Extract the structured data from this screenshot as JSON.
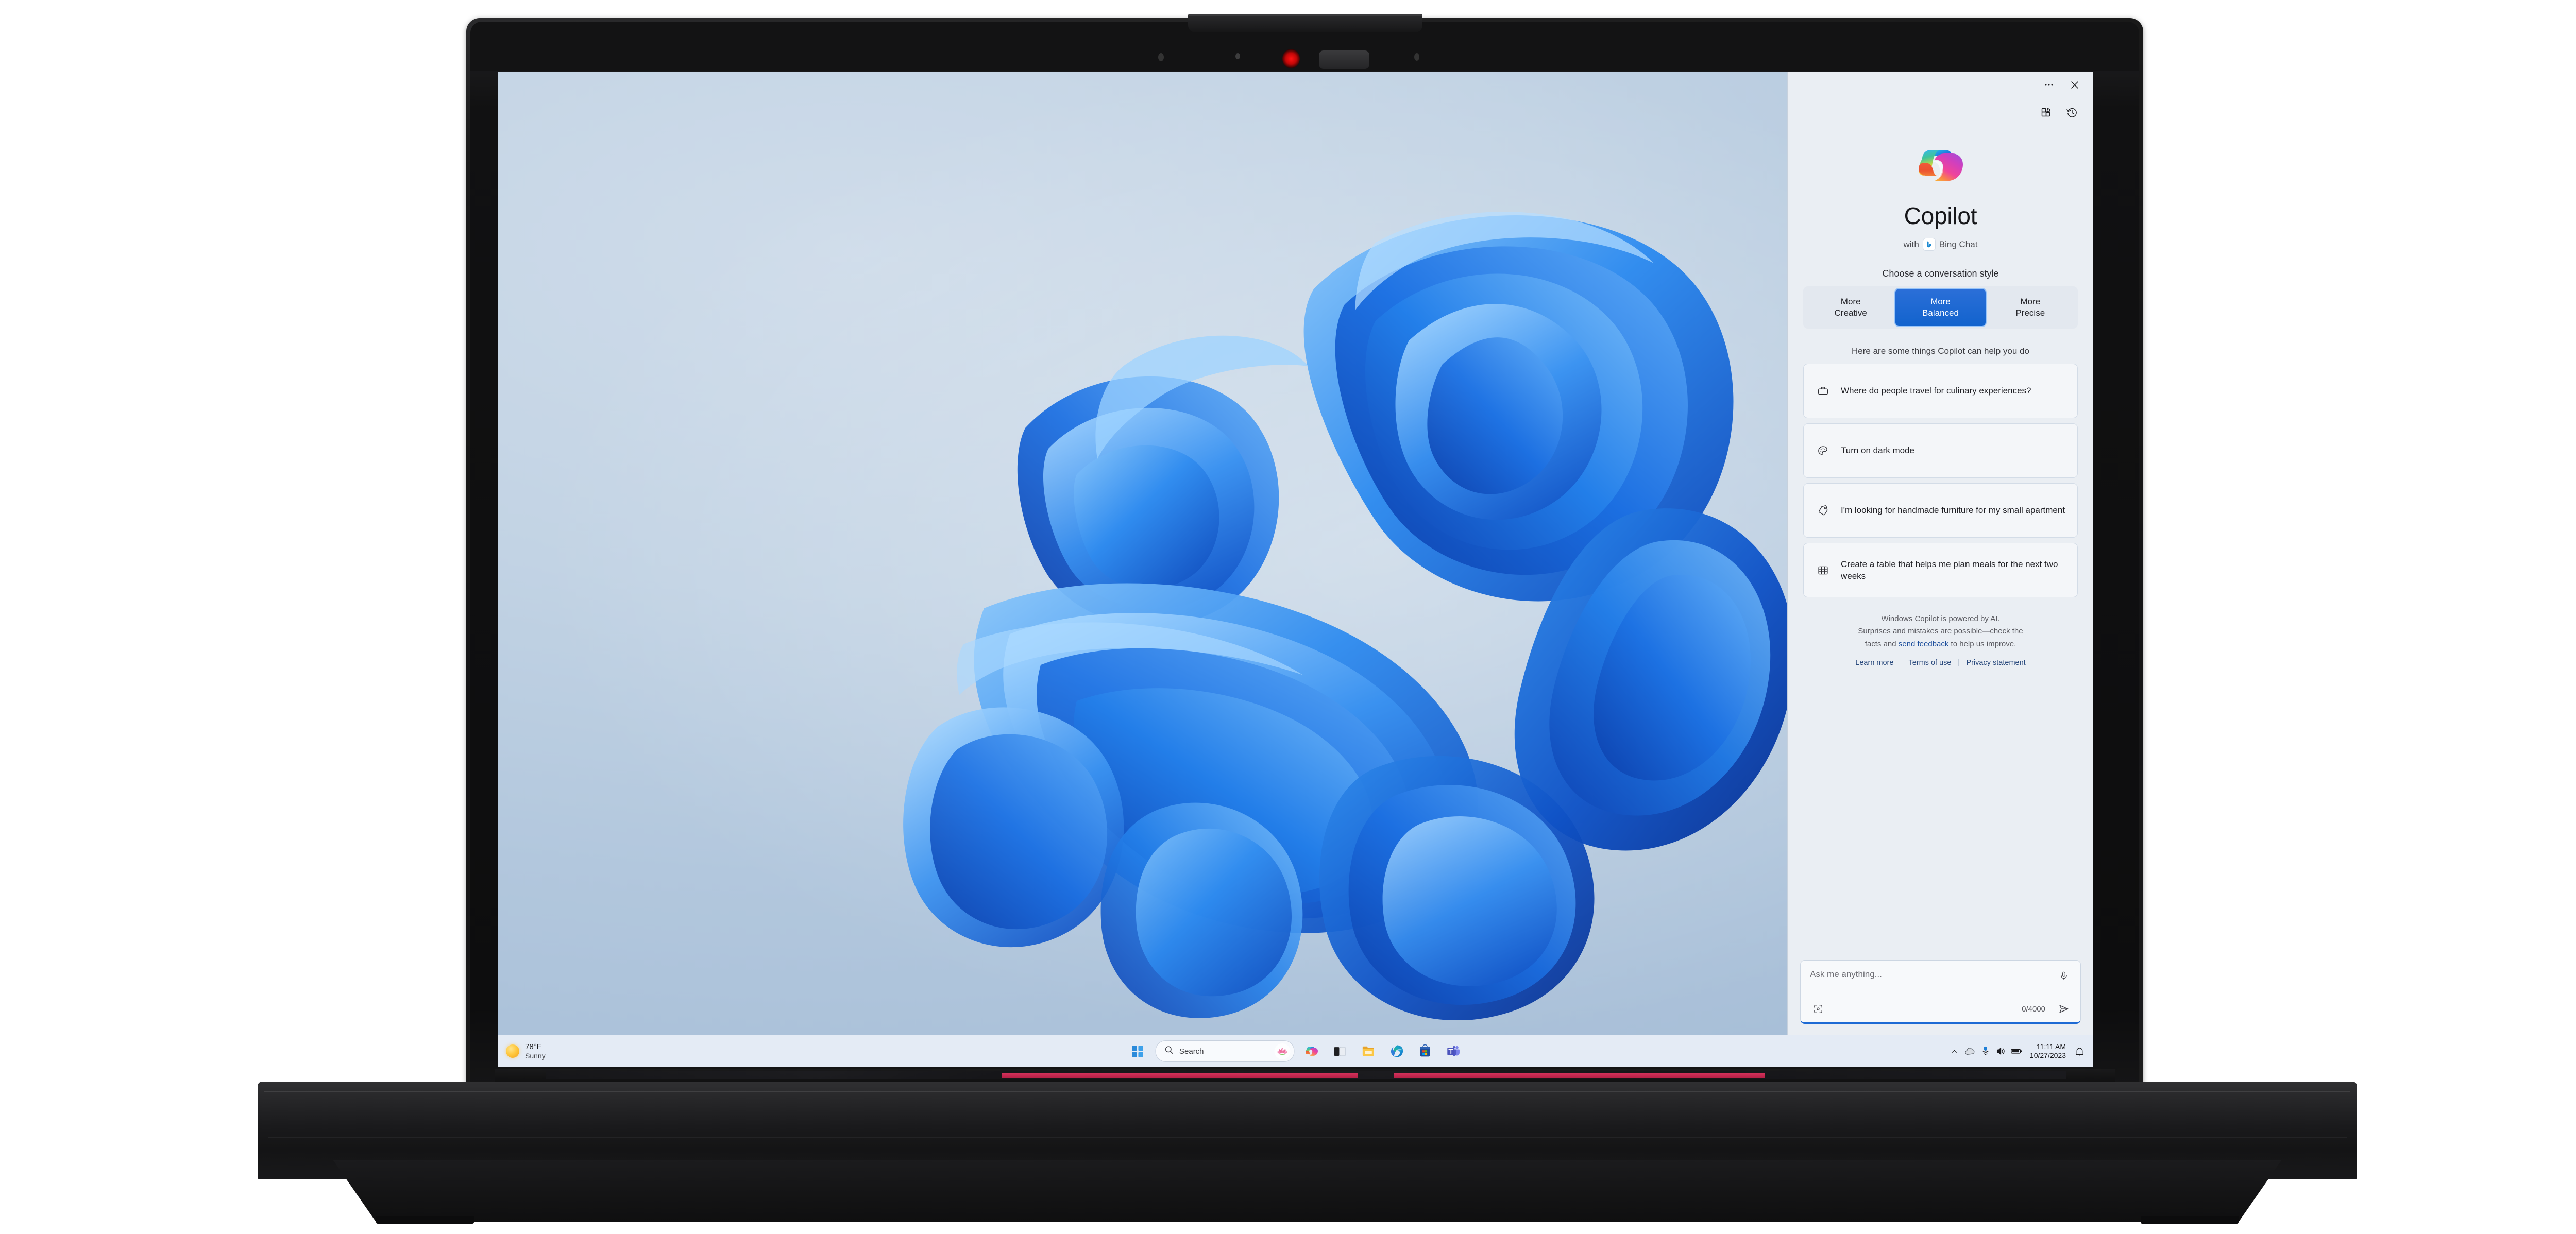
{
  "device": {
    "name": "thinkpad-laptop",
    "webcam": "privacy-shutter-webcam"
  },
  "desktop": {
    "wallpaper_name": "windows-11-bloom",
    "wallpaper_colors": {
      "bg_light": "#cfdcea",
      "bg_deep": "#a8bfd8",
      "petal_mid": "#1f7ae6",
      "petal_light": "#63b2f7",
      "petal_dark": "#0b3fae"
    }
  },
  "taskbar": {
    "weather": {
      "temperature": "78°F",
      "condition": "Sunny",
      "icon": "sun-icon"
    },
    "start_icon": "windows-start-icon",
    "search": {
      "placeholder": "Search",
      "icon": "search-icon",
      "badge_icon": "lotus-icon"
    },
    "apps": [
      {
        "name": "copilot",
        "label": "Copilot",
        "icon": "copilot-icon"
      },
      {
        "name": "task-view",
        "label": "Task View",
        "icon": "task-view-icon"
      },
      {
        "name": "file-explorer",
        "label": "File Explorer",
        "icon": "folder-icon"
      },
      {
        "name": "edge",
        "label": "Microsoft Edge",
        "icon": "edge-icon"
      },
      {
        "name": "store",
        "label": "Microsoft Store",
        "icon": "store-icon"
      },
      {
        "name": "teams",
        "label": "Microsoft Teams",
        "icon": "teams-icon"
      }
    ],
    "tray": {
      "chevron": "chevron-up-icon",
      "onedrive": "cloud-icon",
      "network": "wifi-icon",
      "volume": "speaker-icon",
      "battery": "battery-icon",
      "time": "11:11 AM",
      "date": "10/27/2023",
      "notifications": "bell-icon"
    }
  },
  "copilot": {
    "titlebar": {
      "more_label": "…",
      "close_label": "✕"
    },
    "tools": {
      "plugins_icon": "plugins-icon",
      "history_icon": "history-icon"
    },
    "brand": {
      "logo_icon": "copilot-logo-icon",
      "title": "Copilot",
      "with_text": "with",
      "provider": "Bing Chat",
      "provider_icon": "bing-icon"
    },
    "style": {
      "label": "Choose a conversation style",
      "options": [
        {
          "line1": "More",
          "line2": "Creative",
          "active": false
        },
        {
          "line1": "More",
          "line2": "Balanced",
          "active": true
        },
        {
          "line1": "More",
          "line2": "Precise",
          "active": false
        }
      ],
      "active_color": "#1263cd"
    },
    "suggestions": {
      "label": "Here are some things Copilot can help you do",
      "items": [
        {
          "icon": "briefcase-icon",
          "text": "Where do people travel for culinary experiences?"
        },
        {
          "icon": "palette-icon",
          "text": "Turn on dark mode"
        },
        {
          "icon": "tag-icon",
          "text": "I'm looking for handmade furniture for my small apartment"
        },
        {
          "icon": "table-grid-icon",
          "text": "Create a table that helps me plan meals for the next two weeks"
        }
      ]
    },
    "disclaimer": {
      "line1": "Windows Copilot is powered by AI.",
      "line2_a": "Surprises and mistakes are possible—check the",
      "line2_b": "facts and",
      "feedback_link": "send feedback",
      "line2_c": "to help us improve.",
      "links": [
        {
          "label": "Learn more"
        },
        {
          "label": "Terms of use"
        },
        {
          "label": "Privacy statement"
        }
      ]
    },
    "composer": {
      "placeholder": "Ask me anything...",
      "mic_icon": "microphone-icon",
      "visual_search_icon": "visual-search-icon",
      "char_count": "0/4000",
      "send_icon": "send-icon",
      "focus_color": "#1d6ad4"
    }
  }
}
